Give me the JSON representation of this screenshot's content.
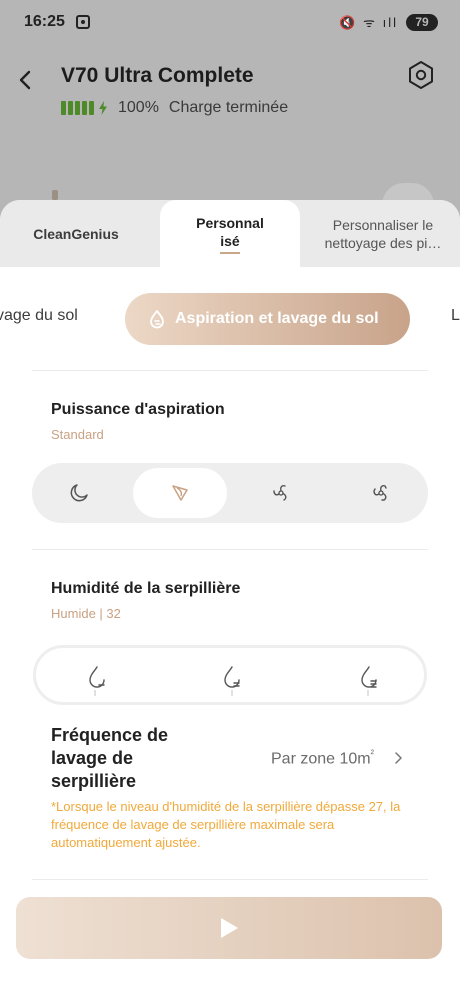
{
  "status_bar": {
    "time": "16:25",
    "signal_icons": "🔇 ᯤ ıll",
    "battery_level": "79"
  },
  "header": {
    "title": "V70 Ultra Complete",
    "battery_percent": "100%",
    "battery_status": "Charge terminée"
  },
  "tabs": [
    {
      "label": "CleanGenius"
    },
    {
      "label": "Personnalisé",
      "selected": true
    },
    {
      "label": "Personnaliser le nettoyage des pi..."
    }
  ],
  "tab_display": {
    "tab2_line1": "Personnal",
    "tab2_line2": "isé",
    "tab3_line1": "Personnaliser le",
    "tab3_line2": "nettoyage des pi…"
  },
  "modes": {
    "left_partial": "vage du sol",
    "active": "Aspiration et lavage du sol",
    "right_partial": "L"
  },
  "suction": {
    "title": "Puissance d'aspiration",
    "value": "Standard",
    "options": [
      "silent-icon",
      "standard-icon",
      "turbo-icon",
      "max-icon"
    ],
    "selected_index": 1
  },
  "mop": {
    "title": "Humidité de la serpillière",
    "value": "Humide | 32",
    "options": [
      "slightly-dry-icon",
      "moist-icon",
      "wet-icon"
    ]
  },
  "frequency": {
    "title": "Fréquence de lavage de serpillière",
    "value": "Par zone 10m²",
    "value_text": "Par zone 10m",
    "value_unit": "²",
    "note": "*Lorsque le niveau d'humidité de la serpillière dépasse 27, la fréquence de lavage de serpillière maximale sera automatiquement ajustée."
  },
  "colors": {
    "accent": "#c9a183",
    "warning": "#f0a93b",
    "battery_green": "#4f8a2a"
  }
}
